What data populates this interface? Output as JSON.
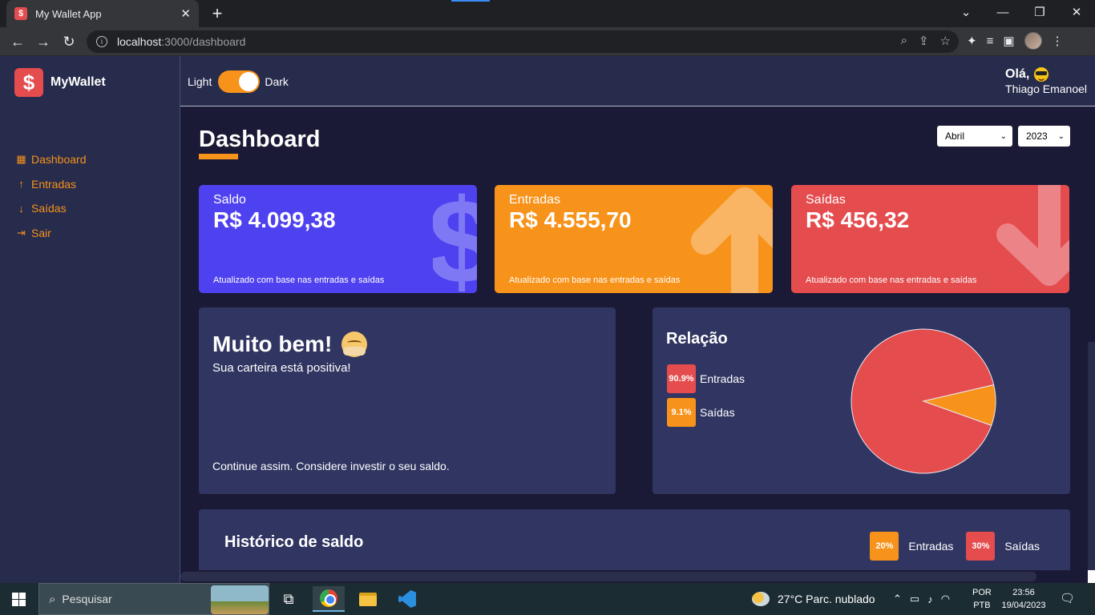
{
  "browser": {
    "tab_title": "My Wallet App",
    "tab_favicon": "$",
    "url_host": "localhost",
    "url_rest": ":3000/dashboard"
  },
  "app": {
    "logo_text": "MyWallet",
    "logo_icon": "$",
    "menu": [
      {
        "label": "Dashboard",
        "icon": "dashboard-icon"
      },
      {
        "label": "Entradas",
        "icon": "arrow-up-icon"
      },
      {
        "label": "Saídas",
        "icon": "arrow-down-icon"
      },
      {
        "label": "Sair",
        "icon": "logout-icon"
      }
    ],
    "theme": {
      "light": "Light",
      "dark": "Dark",
      "is_dark": true
    },
    "greeting": {
      "hello": "Olá,",
      "name": "Thiago Emanoel"
    },
    "page_title": "Dashboard",
    "filters": {
      "month": "Abril",
      "year": "2023"
    },
    "cards": [
      {
        "label": "Saldo",
        "value": "R$ 4.099,38",
        "footer": "Atualizado com base nas entradas e saídas",
        "color": "#4e41f0",
        "icon": "dollar-icon"
      },
      {
        "label": "Entradas",
        "value": "R$ 4.555,70",
        "footer": "Atualizado com base nas entradas e saídas",
        "color": "#f7931b",
        "icon": "arrow-up-icon"
      },
      {
        "label": "Saídas",
        "value": "R$ 456,32",
        "footer": "Atualizado com base nas entradas e saídas",
        "color": "#e44c4e",
        "icon": "arrow-down-icon"
      }
    ],
    "message": {
      "title": "Muito bem!",
      "subtitle": "Sua carteira está positiva!",
      "footer": "Continue assim. Considere investir o seu saldo."
    },
    "relation": {
      "title": "Relação",
      "items": [
        {
          "badge": "90.9%",
          "label": "Entradas",
          "color": "#e44c4e"
        },
        {
          "badge": "9.1%",
          "label": "Saídas",
          "color": "#f7931b"
        }
      ]
    },
    "history": {
      "title": "Histórico de saldo",
      "legend": [
        {
          "badge": "20%",
          "label": "Entradas",
          "color": "#f7931b"
        },
        {
          "badge": "30%",
          "label": "Saídas",
          "color": "#e44c4e"
        }
      ]
    }
  },
  "chart_data": {
    "type": "pie",
    "categories": [
      "Entradas",
      "Saídas"
    ],
    "values": [
      90.9,
      9.1
    ],
    "colors": [
      "#e44c4e",
      "#f7931b"
    ]
  },
  "taskbar": {
    "search_placeholder": "Pesquisar",
    "weather": "27°C  Parc. nublado",
    "lang_top": "POR",
    "lang_bottom": "PTB",
    "time": "23:56",
    "date": "19/04/2023"
  },
  "colors": {
    "accent": "#f7931b",
    "sidebar_bg": "#272b4c",
    "content_bg": "#1b1a36",
    "panel_bg": "#303561"
  }
}
